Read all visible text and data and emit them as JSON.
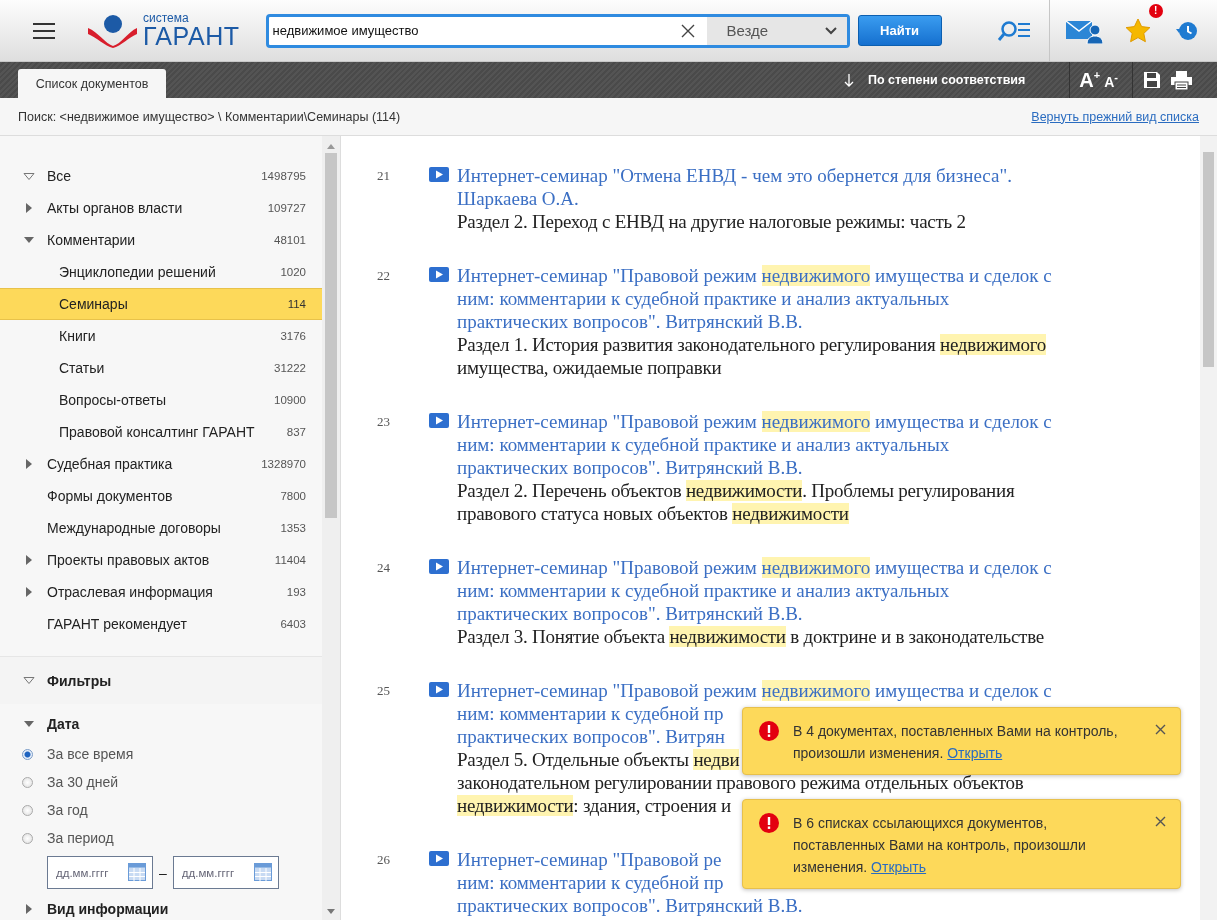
{
  "header": {
    "logo": {
      "tagline": "система",
      "name": "ГАРАНТ"
    },
    "search": {
      "value": "недвижимое имущество",
      "scope": "Везде"
    },
    "search_button": "Найти",
    "favorites_badge": "!"
  },
  "toolbar": {
    "tabs": [
      {
        "label": "Список документов",
        "selected": true
      }
    ],
    "sort": "По степени соответствия",
    "font_larger": "A$^{+}$",
    "font_smaller": "A$^{-}$"
  },
  "breadcrumb": {
    "path": "Поиск: <недвижимое имущество> \\ Комментарии\\Семинары (114)",
    "restore_link": "Вернуть прежний вид списка"
  },
  "tree": [
    {
      "label": "Все",
      "count": "1498795",
      "kind": "root",
      "expanded": true,
      "selected": false
    },
    {
      "label": "Акты органов власти",
      "count": "109727",
      "kind": "branch",
      "expanded": false,
      "selected": false
    },
    {
      "label": "Комментарии",
      "count": "48101",
      "kind": "branch",
      "expanded": true,
      "selected": false,
      "children": [
        {
          "label": "Энциклопедии решений",
          "count": "1020",
          "kind": "leaf",
          "selected": false
        },
        {
          "label": "Семинары",
          "count": "114",
          "kind": "leaf",
          "selected": true
        },
        {
          "label": "Книги",
          "count": "3176",
          "kind": "leaf",
          "selected": false
        },
        {
          "label": "Статьи",
          "count": "31222",
          "kind": "leaf",
          "selected": false
        },
        {
          "label": "Вопросы-ответы",
          "count": "10900",
          "kind": "leaf",
          "selected": false
        },
        {
          "label": "Правовой консалтинг ГАРАНТ",
          "count": "837",
          "kind": "leaf",
          "selected": false
        }
      ]
    },
    {
      "label": "Судебная практика",
      "count": "1328970",
      "kind": "branch",
      "expanded": false,
      "selected": false
    },
    {
      "label": "Формы документов",
      "count": "7800",
      "kind": "leaf",
      "selected": false
    },
    {
      "label": "Международные договоры",
      "count": "1353",
      "kind": "leaf",
      "selected": false
    },
    {
      "label": "Проекты правовых актов",
      "count": "11404",
      "kind": "branch",
      "expanded": false,
      "selected": false
    },
    {
      "label": "Отраслевая информация",
      "count": "193",
      "kind": "branch",
      "expanded": false,
      "selected": false
    },
    {
      "label": "ГАРАНТ рекомендует",
      "count": "6403",
      "kind": "leaf",
      "selected": false
    }
  ],
  "filters": {
    "title": "Фильтры",
    "expanded": true,
    "groups": [
      {
        "title": "Дата",
        "expanded": true,
        "options": [
          {
            "label": "За все время",
            "selected": true
          },
          {
            "label": "За 30 дней",
            "selected": false
          },
          {
            "label": "За год",
            "selected": false
          },
          {
            "label": "За период",
            "selected": false
          }
        ],
        "date_from": {
          "placeholder": "дд.мм.гггг"
        },
        "separator": "–",
        "date_to": {
          "placeholder": "дд.мм.гггг"
        }
      },
      {
        "title": "Вид информации",
        "expanded": false
      }
    ]
  },
  "documents": [
    {
      "number": "21",
      "title_lines": [
        "Интернет-семинар \"Отмена ЕНВД - чем это обернется для бизнеса\".",
        "Шаркаева О.А."
      ],
      "section_lines": [
        "Раздел 2. Переход с ЕНВД на другие налоговые режимы: часть 2"
      ]
    },
    {
      "number": "22",
      "title_lines": [
        "Интернет-семинар \"Правовой режим **недвижимого** имущества и сделок с",
        "ним: комментарии к судебной практике и анализ актуальных",
        "практических вопросов\". Витрянский В.В."
      ],
      "section_lines": [
        "Раздел 1. История развития законодательного регулирования **недвижимого**",
        "имущества, ожидаемые поправки"
      ]
    },
    {
      "number": "23",
      "title_lines": [
        "Интернет-семинар \"Правовой режим **недвижимого** имущества и сделок с",
        "ним: комментарии к судебной практике и анализ актуальных",
        "практических вопросов\". Витрянский В.В."
      ],
      "section_lines": [
        "Раздел 2. Перечень объектов **недвижимости**. Проблемы регулирования",
        "правового статуса новых объектов **недвижимости**"
      ]
    },
    {
      "number": "24",
      "title_lines": [
        "Интернет-семинар \"Правовой режим **недвижимого** имущества и сделок с",
        "ним: комментарии к судебной практике и анализ актуальных",
        "практических вопросов\". Витрянский В.В."
      ],
      "section_lines": [
        "Раздел 3. Понятие объекта **недвижимости** в доктрине и в законодательстве"
      ]
    },
    {
      "number": "25",
      "title_lines": [
        "Интернет-семинар \"Правовой режим **недвижимого** имущества и сделок с",
        "ним: комментарии к судебной пр",
        "практических вопросов\". Витрян"
      ],
      "section_lines": [
        "Раздел 5. Отдельные объекты **недви**",
        "законодательном регулировании правового режима отдельных объектов",
        "**недвижимости**: здания, строения и"
      ]
    },
    {
      "number": "26",
      "title_lines": [
        "Интернет-семинар \"Правовой ре",
        "ним: комментарии к судебной пр",
        "практических вопросов\". Витрянский В.В."
      ]
    }
  ],
  "notifications": [
    {
      "text": "В 4 документах, поставленных Вами на контроль, произошли изменения.",
      "link": "Открыть"
    },
    {
      "text": "В 6 списках ссылающихся документов, поставленных Вами на контроль, произошли изменения.",
      "link": "Открыть"
    }
  ]
}
